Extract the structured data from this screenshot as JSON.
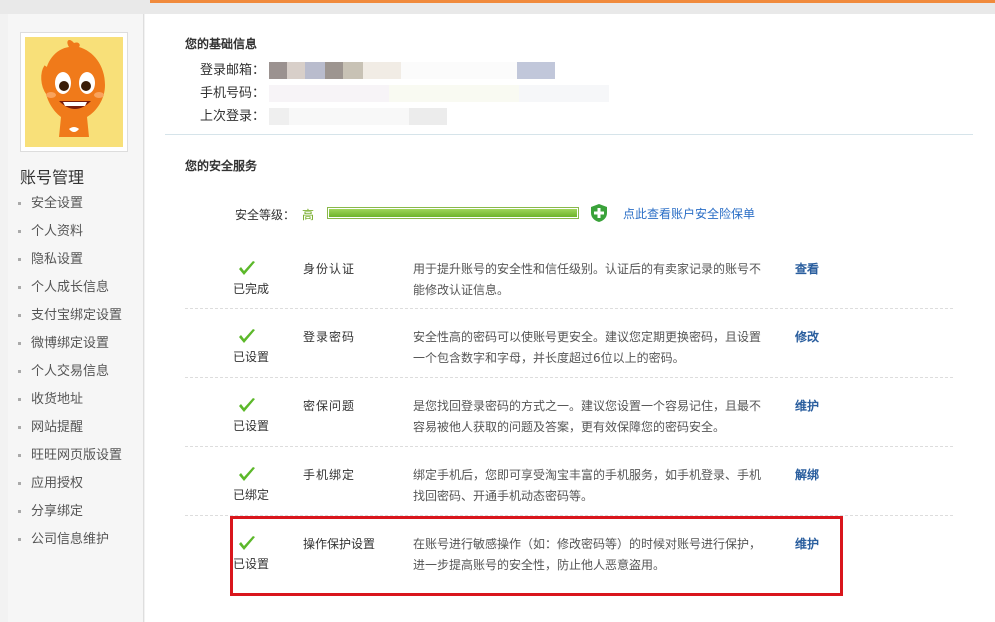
{
  "sidebar": {
    "title": "账号管理",
    "items": [
      {
        "label": "安全设置"
      },
      {
        "label": "个人资料"
      },
      {
        "label": "隐私设置"
      },
      {
        "label": "个人成长信息"
      },
      {
        "label": "支付宝绑定设置"
      },
      {
        "label": "微博绑定设置"
      },
      {
        "label": "个人交易信息"
      },
      {
        "label": "收货地址"
      },
      {
        "label": "网站提醒"
      },
      {
        "label": "旺旺网页版设置"
      },
      {
        "label": "应用授权"
      },
      {
        "label": "分享绑定"
      },
      {
        "label": "公司信息维护"
      }
    ]
  },
  "basic_info": {
    "title": "您的基础信息",
    "email_label": "登录邮箱：",
    "phone_label": "手机号码：",
    "last_login_label": "上次登录："
  },
  "security": {
    "title": "您的安全服务",
    "level_label": "安全等级：",
    "level_value": "高",
    "level_fraction": 1.0,
    "insurance_link": "点此查看账户安全险保单",
    "accent_color": "#6eb42a",
    "highlight_color": "#d9161c",
    "services": [
      {
        "status": "已完成",
        "name": "身份认证",
        "desc": "用于提升账号的安全性和信任级别。认证后的有卖家记录的账号不能修改认证信息。",
        "action": "查看"
      },
      {
        "status": "已设置",
        "name": "登录密码",
        "desc": "安全性高的密码可以使账号更安全。建议您定期更换密码，且设置一个包含数字和字母，并长度超过6位以上的密码。",
        "action": "修改"
      },
      {
        "status": "已设置",
        "name": "密保问题",
        "desc": "是您找回登录密码的方式之一。建议您设置一个容易记住，且最不容易被他人获取的问题及答案，更有效保障您的密码安全。",
        "action": "维护"
      },
      {
        "status": "已绑定",
        "name": "手机绑定",
        "desc": "绑定手机后，您即可享受淘宝丰富的手机服务，如手机登录、手机找回密码、开通手机动态密码等。",
        "action": "解绑"
      },
      {
        "status": "已设置",
        "name": "操作保护设置",
        "desc": "在账号进行敏感操作（如：修改密码等）的时候对账号进行保护，进一步提高账号的安全性，防止他人恶意盗用。",
        "action": "维护"
      }
    ]
  }
}
